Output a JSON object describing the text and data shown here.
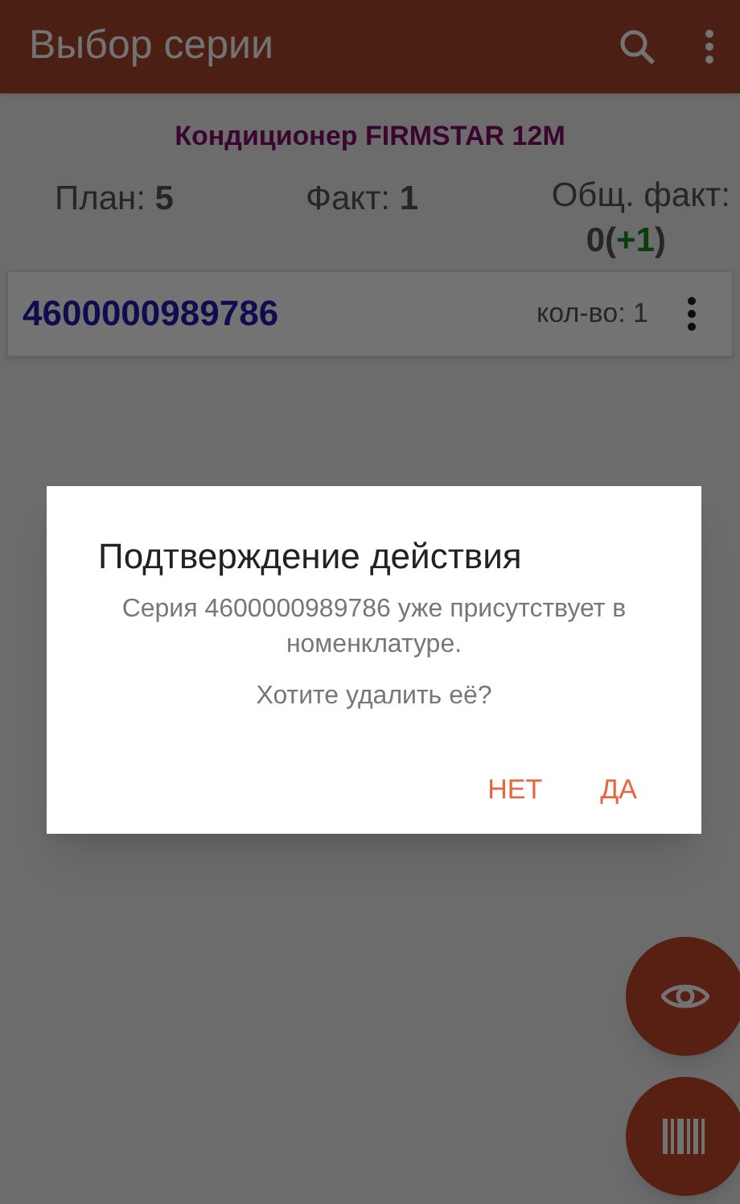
{
  "app_bar": {
    "title": "Выбор серии"
  },
  "product": "Кондиционер FIRMSTAR 12M",
  "stats": [
    {
      "label": "План: ",
      "value": "5"
    },
    {
      "label": "Факт: ",
      "value": "1"
    }
  ],
  "total": {
    "label": "Общ. факт:",
    "segments": [
      {
        "text": "0(",
        "kind": "plain"
      },
      {
        "text": "+1",
        "kind": "delta"
      },
      {
        "text": ")",
        "kind": "plain"
      }
    ]
  },
  "series": [
    {
      "code": "4600000989786",
      "quantity": "кол-во: 1"
    }
  ],
  "dialog": {
    "title": "Подтверждение действия",
    "message": "Серия 4600000989786 уже присутствует в номенклатуре.",
    "question": "Хотите удалить её?",
    "buttons": [
      "НЕТ",
      "ДА"
    ]
  }
}
